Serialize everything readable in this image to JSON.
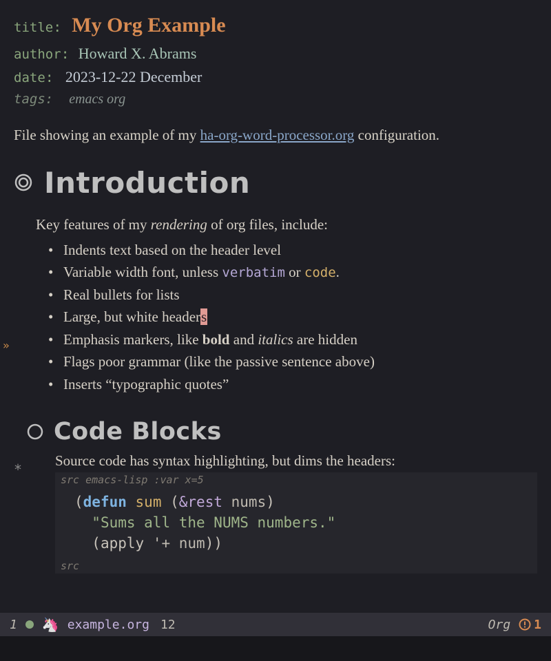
{
  "meta": {
    "title_key": "title",
    "title_val": "My Org Example",
    "author_key": "author",
    "author_val": "Howard X. Abrams",
    "date_key": "date",
    "date_val": "2023-12-22 December",
    "tags_key": "tags:",
    "tags_val": "emacs org"
  },
  "intro": {
    "pre": "File showing an example of my ",
    "link": "ha-org-word-processor.org",
    "post": " configuration."
  },
  "h1": "Introduction",
  "features_lead_pre": "Key features of my ",
  "features_lead_em": "rendering",
  "features_lead_post": " of org files, include:",
  "features": {
    "f0": "Indents text based on the header level",
    "f1_pre": "Variable width font, unless ",
    "f1_verbatim": "verbatim",
    "f1_mid": " or ",
    "f1_code": "code",
    "f1_post": ".",
    "f2": "Real bullets for lists",
    "f3_pre": "Large, but white header",
    "f3_cursor": "s",
    "f4_pre": "Emphasis markers, like ",
    "f4_bold": "bold",
    "f4_mid": " and ",
    "f4_italics": "italics",
    "f4_post": " are hidden",
    "f5": "Flags poor grammar (like the passive sentence above)",
    "f6": "Inserts “typographic quotes”"
  },
  "h2": "Code Blocks",
  "src_intro": "Source code has syntax highlighting, but dims the headers:",
  "src_header_label": "src",
  "src_lang": "emacs-lisp :var x=5",
  "code": {
    "l1_open": "(",
    "l1_kw": "defun",
    "l1_sp": " ",
    "l1_fn": "sum",
    "l1_args_open": " (",
    "l1_amp": "&rest",
    "l1_argssp": " ",
    "l1_arg": "nums",
    "l1_close": ")",
    "l2_str": "\"Sums all the NUMS numbers.\"",
    "l3_open": "(",
    "l3_apply": "apply ",
    "l3_quote": "'+",
    "l3_sp": " ",
    "l3_arg": "num",
    "l3_close": "))"
  },
  "src_footer": "src",
  "modeline": {
    "left_num": "1",
    "filename": "example.org",
    "position": "12",
    "major_mode": "Org",
    "warn_count": "1"
  },
  "fringe_glyph": "»",
  "star_glyph": "*"
}
